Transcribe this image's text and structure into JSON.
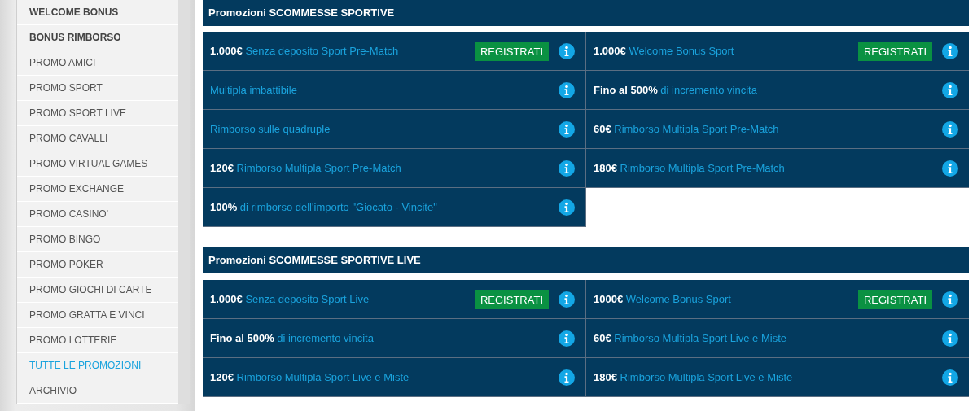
{
  "sidebar": {
    "items": [
      {
        "label": "WELCOME BONUS",
        "kind": "bonus"
      },
      {
        "label": "BONUS RIMBORSO",
        "kind": "bonus"
      },
      {
        "label": "PROMO AMICI",
        "kind": "promo"
      },
      {
        "label": "PROMO SPORT",
        "kind": "promo"
      },
      {
        "label": "PROMO SPORT LIVE",
        "kind": "promo"
      },
      {
        "label": "PROMO CAVALLI",
        "kind": "promo"
      },
      {
        "label": "PROMO VIRTUAL GAMES",
        "kind": "promo"
      },
      {
        "label": "PROMO EXCHANGE",
        "kind": "promo"
      },
      {
        "label": "PROMO CASINO'",
        "kind": "promo"
      },
      {
        "label": "PROMO BINGO",
        "kind": "promo"
      },
      {
        "label": "PROMO POKER",
        "kind": "promo"
      },
      {
        "label": "PROMO GIOCHI DI CARTE",
        "kind": "promo"
      },
      {
        "label": "PROMO GRATTA E VINCI",
        "kind": "promo"
      },
      {
        "label": "PROMO LOTTERIE",
        "kind": "promo"
      },
      {
        "label": "TUTTE LE PROMOZIONI",
        "kind": "all"
      },
      {
        "label": "ARCHIVIO",
        "kind": "promo"
      }
    ]
  },
  "sections": [
    {
      "title": "Promozioni SCOMMESSE SPORTIVE",
      "promos": [
        {
          "text": "**1.000€** Senza deposito Sport Pre-Match",
          "button": "REGISTRATI"
        },
        {
          "text": "**1.000€** Welcome Bonus Sport",
          "button": "REGISTRATI"
        },
        {
          "text": "Multipla imbattibile"
        },
        {
          "text": "**Fino al 500%** di incremento vincita"
        },
        {
          "text": "Rimborso sulle quadruple"
        },
        {
          "text": "**60€** Rimborso Multipla Sport Pre-Match"
        },
        {
          "text": "**120€** Rimborso Multipla Sport Pre-Match"
        },
        {
          "text": "**180€** Rimborso Multipla Sport Pre-Match"
        },
        {
          "text": "**100%** di rimborso dell'importo \"Giocato - Vincite\""
        }
      ]
    },
    {
      "title": "Promozioni SCOMMESSE SPORTIVE LIVE",
      "promos": [
        {
          "text": "**1.000€** Senza deposito Sport Live",
          "button": "REGISTRATI"
        },
        {
          "text": "**1000€** Welcome Bonus Sport",
          "button": "REGISTRATI"
        },
        {
          "text": "**Fino al 500%** di incremento vincita"
        },
        {
          "text": "**60€** Rimborso Multipla Sport Live e Miste"
        },
        {
          "text": "**120€** Rimborso Multipla Sport Live e Miste"
        },
        {
          "text": "**180€** Rimborso Multipla Sport Live e Miste"
        }
      ]
    }
  ]
}
